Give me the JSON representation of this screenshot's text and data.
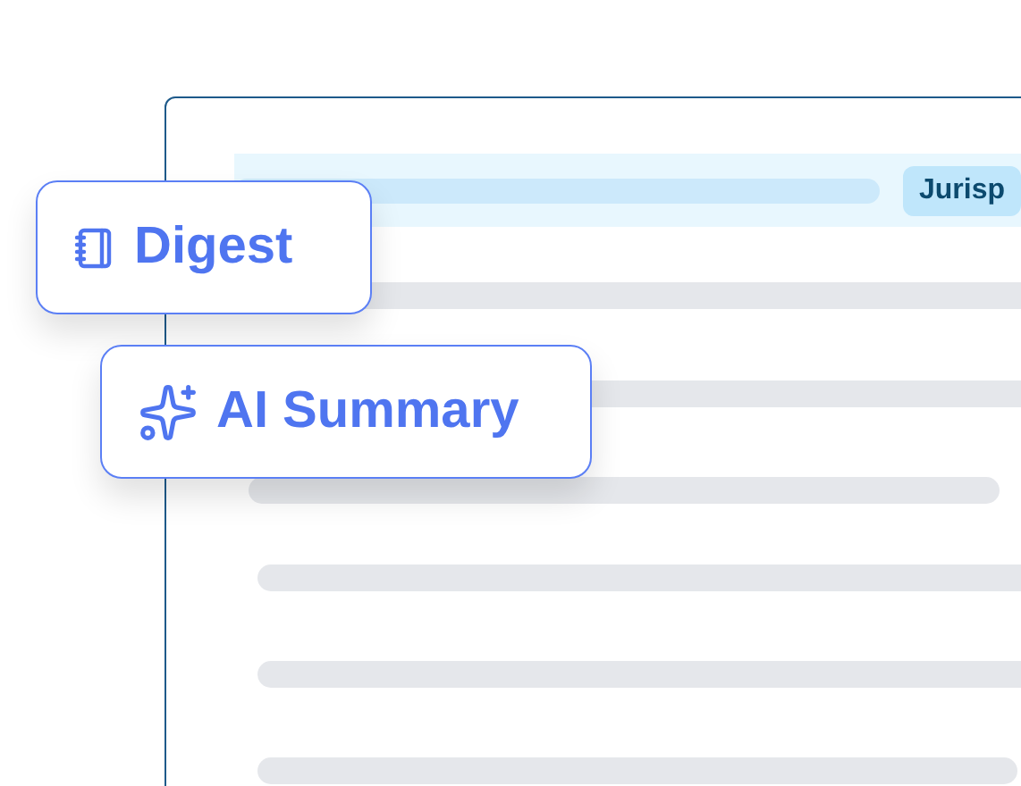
{
  "document": {
    "tag": "Jurisp"
  },
  "cards": [
    {
      "label": "Digest",
      "kind": "notebook"
    },
    {
      "label": "AI Summary",
      "kind": "sparkle"
    }
  ]
}
